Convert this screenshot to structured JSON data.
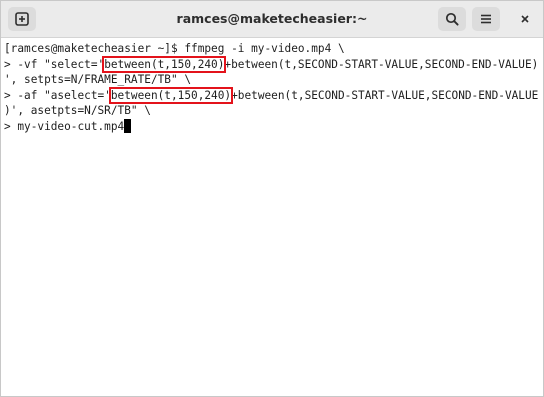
{
  "window": {
    "title": "ramces@maketecheasier:~"
  },
  "icons": {
    "new_tab": "new-tab-icon",
    "search": "search-icon",
    "menu": "hamburger-menu-icon",
    "close": "close-icon"
  },
  "colors": {
    "highlight_box": "#e3131b",
    "headerbar": "#ebebeb",
    "terminal_bg": "#ffffff",
    "terminal_fg": "#1e1e1e"
  },
  "terminal": {
    "line1": "[ramces@maketecheasier ~]$ ffmpeg -i my-video.mp4 \\",
    "line2_pre": "> -vf \"select='",
    "line2_hl": "between(t,150,240)",
    "line2_post": "+between(t,SECOND-START-VALUE,SECOND-END-VALUE)",
    "line3": "', setpts=N/FRAME_RATE/TB\" \\",
    "line4_pre": "> -af \"aselect='",
    "line4_hl": "between(t,150,240)",
    "line4_post": "+between(t,SECOND-START-VALUE,SECOND-END-VALUE",
    "line5": ")', asetpts=N/SR/TB\" \\",
    "line6": "> my-video-cut.mp4"
  }
}
